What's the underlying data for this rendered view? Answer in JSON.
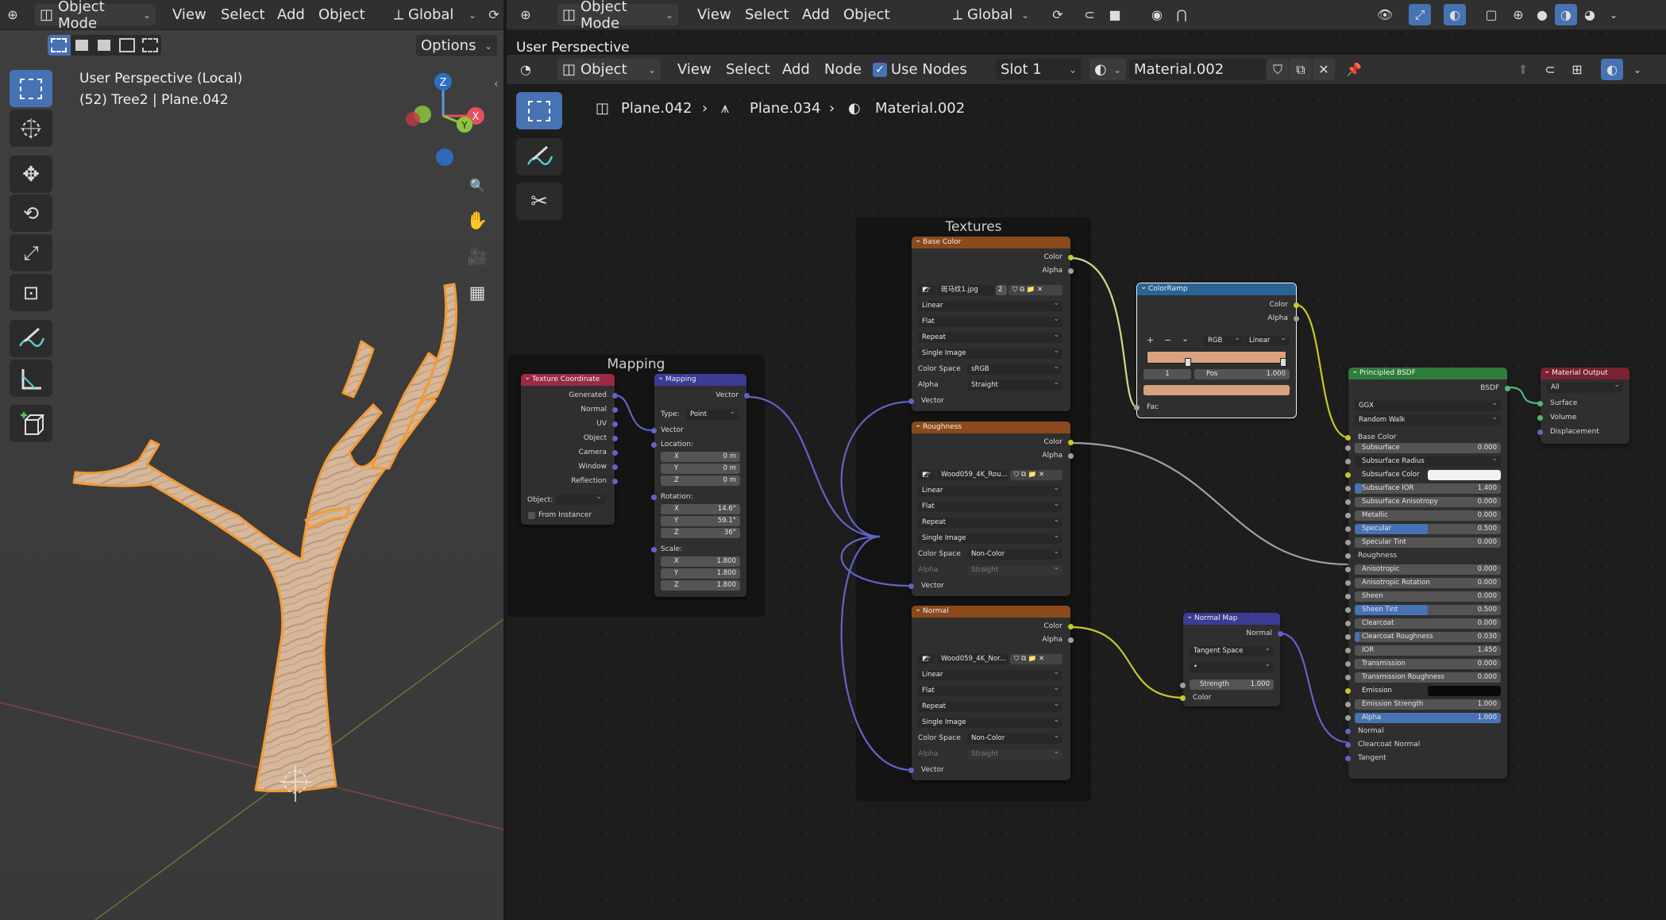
{
  "left_header": {
    "mode": "Object Mode",
    "menus": [
      "View",
      "Select",
      "Add",
      "Object"
    ],
    "orientation": "Global",
    "options_label": "Options"
  },
  "left_viewport": {
    "title": "User Perspective (Local)",
    "subtitle": "(52) Tree2 | Plane.042",
    "gizmo": {
      "z": "Z",
      "x": "X",
      "y": "Y"
    }
  },
  "right_header": {
    "mode": "Object Mode",
    "menus": [
      "View",
      "Select",
      "Add",
      "Object"
    ],
    "orientation": "Global",
    "viewport_label": "User Perspective"
  },
  "node_header": {
    "object_type": "Object",
    "menus": [
      "View",
      "Select",
      "Add",
      "Node"
    ],
    "use_nodes_label": "Use Nodes",
    "use_nodes_checked": true,
    "slot": "Slot 1",
    "material": "Material.002"
  },
  "breadcrumb": [
    "Plane.042",
    "Plane.034",
    "Material.002"
  ],
  "frames": {
    "mapping": "Mapping",
    "textures": "Textures"
  },
  "nodes": {
    "tex_coord": {
      "title": "Texture Coordinate",
      "outputs": [
        "Generated",
        "Normal",
        "UV",
        "Object",
        "Camera",
        "Window",
        "Reflection"
      ],
      "object_label": "Object:",
      "from_instancer": "From Instancer"
    },
    "mapping": {
      "title": "Mapping",
      "output": "Vector",
      "type_label": "Type:",
      "type_value": "Point",
      "vector_in": "Vector",
      "location_label": "Location:",
      "location": [
        [
          "X",
          "0 m"
        ],
        [
          "Y",
          "0 m"
        ],
        [
          "Z",
          "0 m"
        ]
      ],
      "rotation_label": "Rotation:",
      "rotation": [
        [
          "X",
          "14.6°"
        ],
        [
          "Y",
          "59.1°"
        ],
        [
          "Z",
          "36°"
        ]
      ],
      "scale_label": "Scale:",
      "scale": [
        [
          "X",
          "1.800"
        ],
        [
          "Y",
          "1.800"
        ],
        [
          "Z",
          "1.800"
        ]
      ]
    },
    "base_color": {
      "title": "Base Color",
      "outputs": [
        "Color",
        "Alpha"
      ],
      "image": "斑马纹1.jpg",
      "users": "2",
      "interp": "Linear",
      "proj": "Flat",
      "ext": "Repeat",
      "source": "Single Image",
      "cs_label": "Color Space",
      "cs_value": "sRGB",
      "alpha_label": "Alpha",
      "alpha_value": "Straight",
      "vector_in": "Vector"
    },
    "roughness": {
      "title": "Roughness",
      "outputs": [
        "Color",
        "Alpha"
      ],
      "image": "Wood059_4K_Rou...",
      "interp": "Linear",
      "proj": "Flat",
      "ext": "Repeat",
      "source": "Single Image",
      "cs_label": "Color Space",
      "cs_value": "Non-Color",
      "alpha_label": "Alpha",
      "alpha_value": "Straight",
      "vector_in": "Vector"
    },
    "normal_tex": {
      "title": "Normal",
      "outputs": [
        "Color",
        "Alpha"
      ],
      "image": "Wood059_4K_Nor...",
      "interp": "Linear",
      "proj": "Flat",
      "ext": "Repeat",
      "source": "Single Image",
      "cs_label": "Color Space",
      "cs_value": "Non-Color",
      "alpha_label": "Alpha",
      "alpha_value": "Straight",
      "vector_in": "Vector"
    },
    "color_ramp": {
      "title": "ColorRamp",
      "outputs": [
        "Color",
        "Alpha"
      ],
      "controls": [
        "+",
        "−",
        "⌄"
      ],
      "color_mode": "RGB",
      "interpolation": "Linear",
      "stop_index": "1",
      "pos_label": "Pos",
      "pos_value": "1.000",
      "fac": "Fac",
      "swatch": "#d7a27d"
    },
    "normal_map": {
      "title": "Normal Map",
      "output": "Normal",
      "space": "Tangent Space",
      "strength_label": "Strength",
      "strength_value": "1.000",
      "color_in": "Color"
    },
    "principled": {
      "title": "Principled BSDF",
      "output": "BSDF",
      "distribution": "GGX",
      "subsurface_method": "Random Walk",
      "base_color": "Base Color",
      "params": [
        [
          "Subsurface",
          "0.000"
        ],
        [
          "Subsurface Radius",
          ""
        ],
        [
          "Subsurface Color",
          ""
        ],
        [
          "Subsurface IOR",
          "1.400"
        ],
        [
          "Subsurface Anisotropy",
          "0.000"
        ],
        [
          "Metallic",
          "0.000"
        ],
        [
          "Specular",
          "0.500"
        ],
        [
          "Specular Tint",
          "0.000"
        ],
        [
          "Roughness",
          ""
        ],
        [
          "Anisotropic",
          "0.000"
        ],
        [
          "Anisotropic Rotation",
          "0.000"
        ],
        [
          "Sheen",
          "0.000"
        ],
        [
          "Sheen Tint",
          "0.500"
        ],
        [
          "Clearcoat",
          "0.000"
        ],
        [
          "Clearcoat Roughness",
          "0.030"
        ],
        [
          "IOR",
          "1.450"
        ],
        [
          "Transmission",
          "0.000"
        ],
        [
          "Transmission Roughness",
          "0.000"
        ],
        [
          "Emission",
          ""
        ],
        [
          "Emission Strength",
          "1.000"
        ],
        [
          "Alpha",
          "1.000"
        ],
        [
          "Normal",
          ""
        ],
        [
          "Clearcoat Normal",
          ""
        ],
        [
          "Tangent",
          ""
        ]
      ]
    },
    "material_output": {
      "title": "Material Output",
      "target": "All",
      "inputs": [
        "Surface",
        "Volume",
        "Displacement"
      ]
    }
  },
  "colors": {
    "accent": "#4772b3",
    "selection_outline": "#f29a37",
    "texture_header": "#8a4a1c",
    "shader_header": "#2f7d3a",
    "input_header": "#9a2a45",
    "vector_header": "#3c3c94",
    "converter_header": "#2a6494",
    "output_header": "#7a2232"
  }
}
